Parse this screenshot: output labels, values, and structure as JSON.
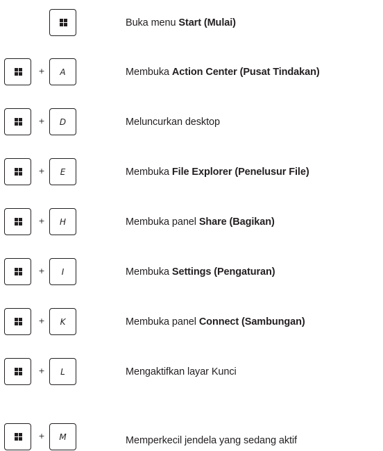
{
  "shortcuts": [
    {
      "key": "",
      "pre": "Buka menu ",
      "bold": "Start (Mulai)",
      "post": ""
    },
    {
      "key": "A",
      "pre": "Membuka ",
      "bold": "Action Center (Pusat Tindakan)",
      "post": ""
    },
    {
      "key": "D",
      "pre": "Meluncurkan desktop",
      "bold": "",
      "post": ""
    },
    {
      "key": "E",
      "pre": "Membuka ",
      "bold": "File Explorer (Penelusur File)",
      "post": ""
    },
    {
      "key": "H",
      "pre": "Membuka panel ",
      "bold": "Share (Bagikan)",
      "post": ""
    },
    {
      "key": "I",
      "pre": "Membuka ",
      "bold": "Settings (Pengaturan)",
      "post": ""
    },
    {
      "key": "K",
      "pre": "Membuka panel ",
      "bold": "Connect (Sambungan)",
      "post": ""
    },
    {
      "key": "L",
      "pre": "Mengaktifkan layar Kunci",
      "bold": "",
      "post": ""
    },
    {
      "key": "M",
      "pre": "Memperkecil jendela yang sedang aktif",
      "bold": "",
      "post": ""
    }
  ],
  "plus_sign": "+",
  "icons": {
    "windows_key": "windows-logo-icon"
  }
}
